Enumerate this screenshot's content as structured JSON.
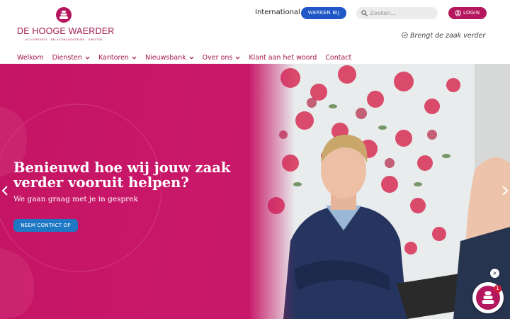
{
  "logo": {
    "name": "DE HOOGE WAERDER",
    "subtitle": "ACCOUNTANTS · BELASTINGADVISEURS · JURISTEN",
    "icon": "stacked-stones-icon"
  },
  "utility": {
    "international_label": "International",
    "werken_label": "WERKEN BIJ",
    "search_placeholder": "Zoeken...",
    "login_label": "LOGIN"
  },
  "tagline": "Brengt de zaak verder",
  "nav": {
    "items": [
      {
        "label": "Welkom",
        "dropdown": false
      },
      {
        "label": "Diensten",
        "dropdown": true
      },
      {
        "label": "Kantoren",
        "dropdown": true
      },
      {
        "label": "Nieuwsbank",
        "dropdown": true
      },
      {
        "label": "Over ons",
        "dropdown": true
      },
      {
        "label": "Klant aan het woord",
        "dropdown": false
      },
      {
        "label": "Contact",
        "dropdown": false
      }
    ]
  },
  "hero": {
    "title": "Benieuwd hoe wij jouw zaak verder vooruit helpen?",
    "subtitle": "We gaan graag met je in gesprek",
    "cta_label": "NEEM CONTACT OP"
  },
  "chat": {
    "badge_count": "1",
    "close_glyph": "×"
  },
  "colors": {
    "brand": "#a3164f",
    "hero_pink": "#c71566",
    "werken_button": "#1f57c7",
    "cta_button": "#1e78c4"
  }
}
